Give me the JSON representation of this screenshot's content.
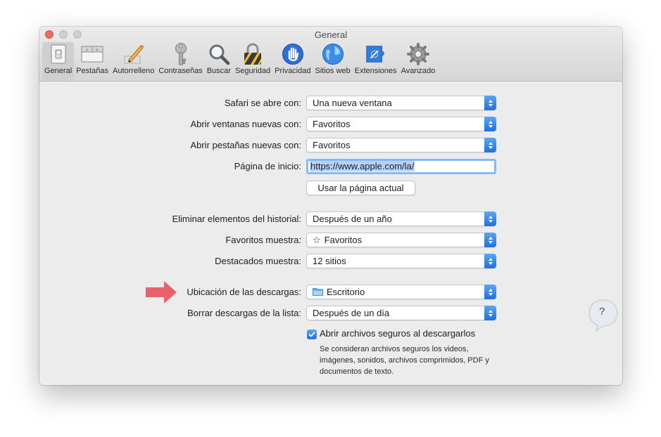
{
  "window": {
    "title": "General"
  },
  "toolbar": {
    "items": [
      {
        "label": "General",
        "icon": "switch-icon",
        "active": true
      },
      {
        "label": "Pestañas",
        "icon": "tabs-icon"
      },
      {
        "label": "Autorrelleno",
        "icon": "pencil-icon"
      },
      {
        "label": "Contraseñas",
        "icon": "key-icon"
      },
      {
        "label": "Buscar",
        "icon": "magnifier-icon"
      },
      {
        "label": "Seguridad",
        "icon": "lock-icon"
      },
      {
        "label": "Privacidad",
        "icon": "hand-icon"
      },
      {
        "label": "Sitios web",
        "icon": "globe-icon"
      },
      {
        "label": "Extensiones",
        "icon": "puzzle-icon"
      },
      {
        "label": "Avanzado",
        "icon": "gear-icon"
      }
    ]
  },
  "settings": {
    "opens_with": {
      "label": "Safari se abre con:",
      "value": "Una nueva ventana"
    },
    "new_windows": {
      "label": "Abrir ventanas nuevas con:",
      "value": "Favoritos"
    },
    "new_tabs": {
      "label": "Abrir pestañas nuevas con:",
      "value": "Favoritos"
    },
    "homepage": {
      "label": "Página de inicio:",
      "value": "https://www.apple.com/la/"
    },
    "use_current_page": {
      "label": "Usar la página actual"
    },
    "remove_history": {
      "label": "Eliminar elementos del historial:",
      "value": "Después de un año"
    },
    "favorites_shows": {
      "label": "Favoritos muestra:",
      "value": "Favoritos"
    },
    "top_sites_shows": {
      "label": "Destacados muestra:",
      "value": "12 sitios"
    },
    "download_location": {
      "label": "Ubicación de las descargas:",
      "value": "Escritorio"
    },
    "remove_downloads": {
      "label": "Borrar descargas de la lista:",
      "value": "Después de un día"
    },
    "open_safe_files": {
      "label": "Abrir archivos seguros al descargarlos",
      "checked": true,
      "note": "Se consideran archivos seguros los videos, imágenes, sonidos, archivos comprimidos, PDF y documentos de texto."
    }
  },
  "help": {
    "label": "?"
  },
  "colors": {
    "accent": "#1f6fe0",
    "close": "#ed6a5e",
    "annotation_arrow": "#e8626a"
  }
}
